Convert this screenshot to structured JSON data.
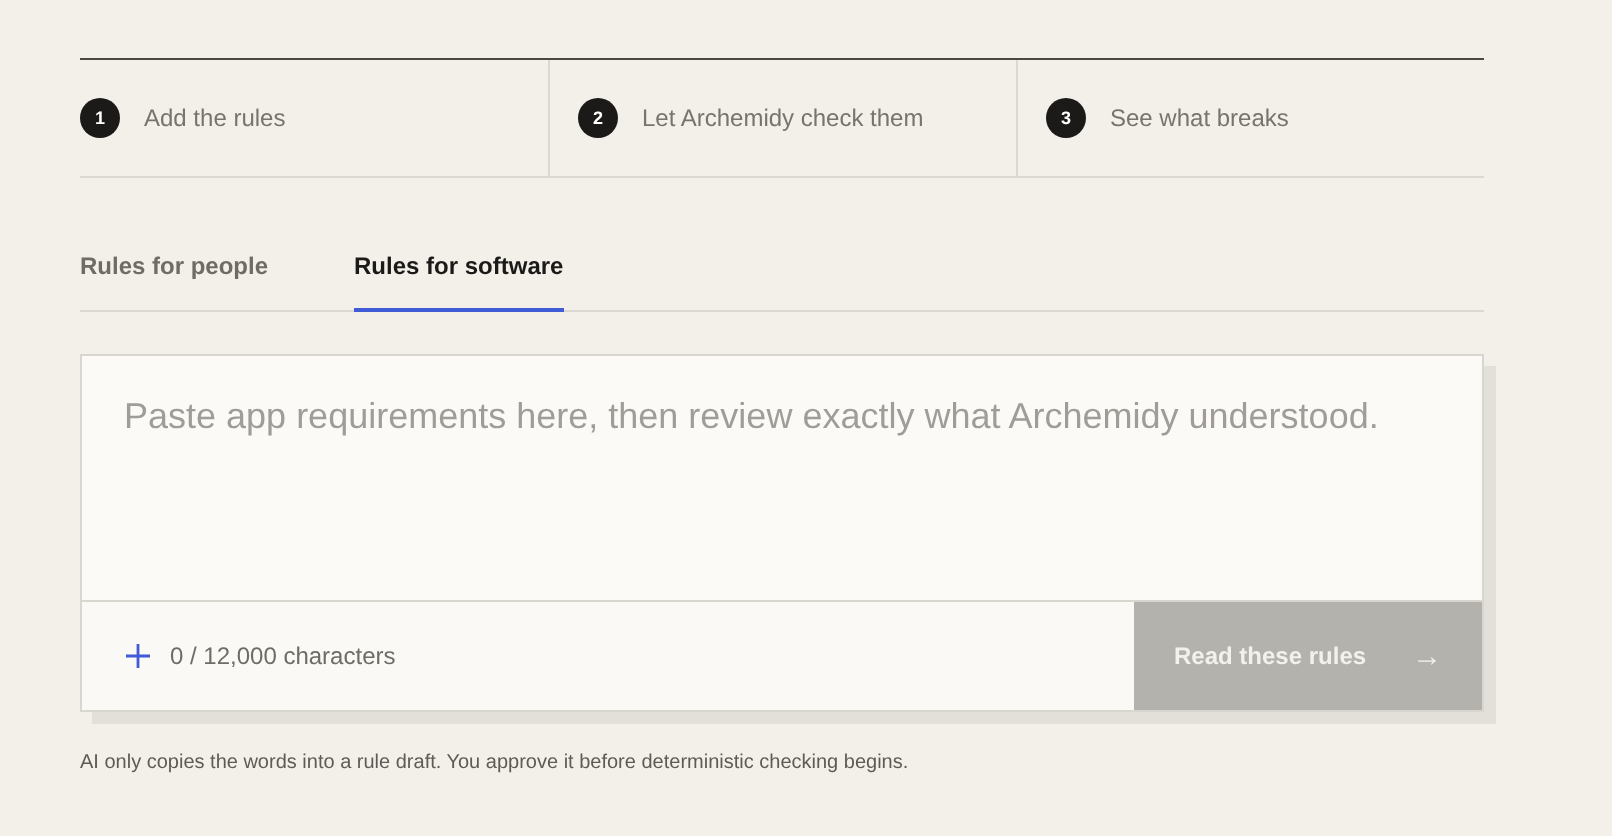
{
  "steps": [
    {
      "number": "1",
      "label": "Add the rules"
    },
    {
      "number": "2",
      "label": "Let Archemidy check them"
    },
    {
      "number": "3",
      "label": "See what breaks"
    }
  ],
  "tabs": [
    {
      "label": "Rules for people",
      "selected": false
    },
    {
      "label": "Rules for software",
      "selected": true
    }
  ],
  "editor": {
    "placeholder": "Paste app requirements here, then review exactly what Archemidy understood.",
    "counter": "0 / 12,000 characters",
    "button": {
      "label": "Read these rules",
      "arrow": "→",
      "disabled": true
    }
  },
  "note": "AI only copies the words into a rule draft. You approve it before deterministic checking begins."
}
